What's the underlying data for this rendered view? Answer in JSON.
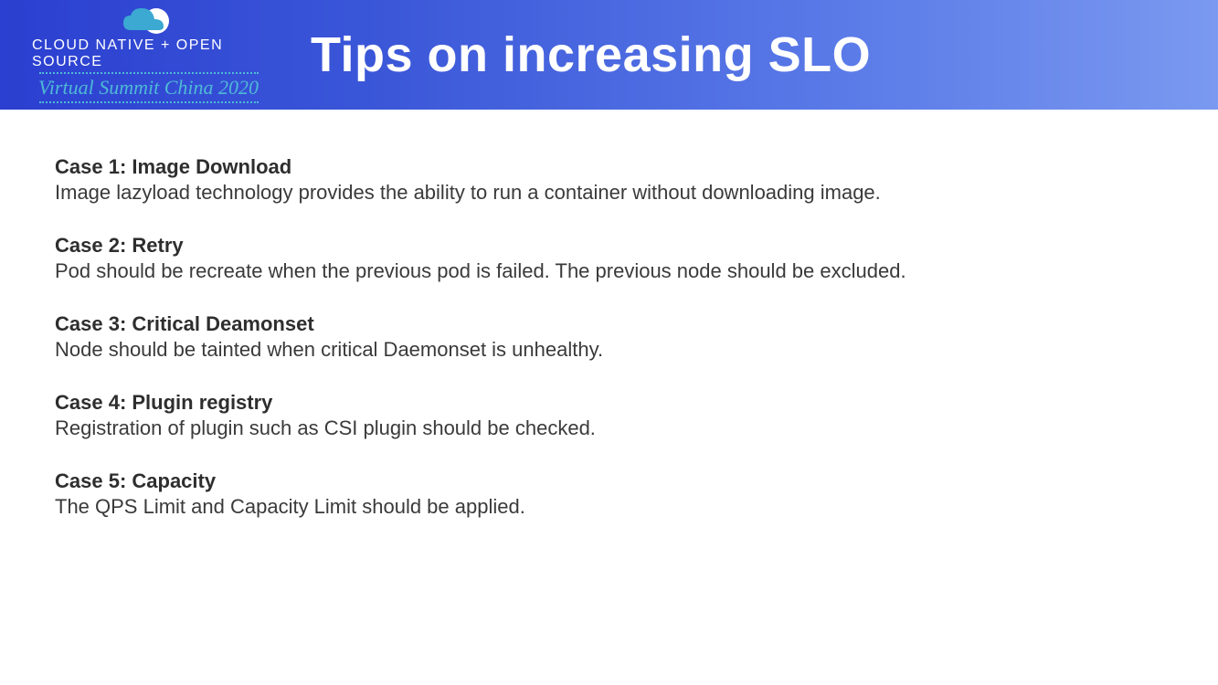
{
  "header": {
    "logo_line1": "CLOUD NATIVE + OPEN SOURCE",
    "logo_line2": "Virtual Summit China 2020",
    "title": "Tips on increasing SLO"
  },
  "cases": [
    {
      "heading": "Case 1: Image Download",
      "body": "Image lazyload technology provides the ability to run a container without downloading image."
    },
    {
      "heading": "Case 2: Retry",
      "body": "Pod should be recreate when the previous pod is failed. The previous node should be excluded."
    },
    {
      "heading": "Case 3: Critical Deamonset",
      "body": "Node should be tainted when critical Daemonset is unhealthy."
    },
    {
      "heading": "Case 4: Plugin registry",
      "body": "Registration of plugin such as CSI plugin should be checked."
    },
    {
      "heading": "Case 5: Capacity",
      "body": "The QPS Limit and Capacity Limit should be applied."
    }
  ]
}
